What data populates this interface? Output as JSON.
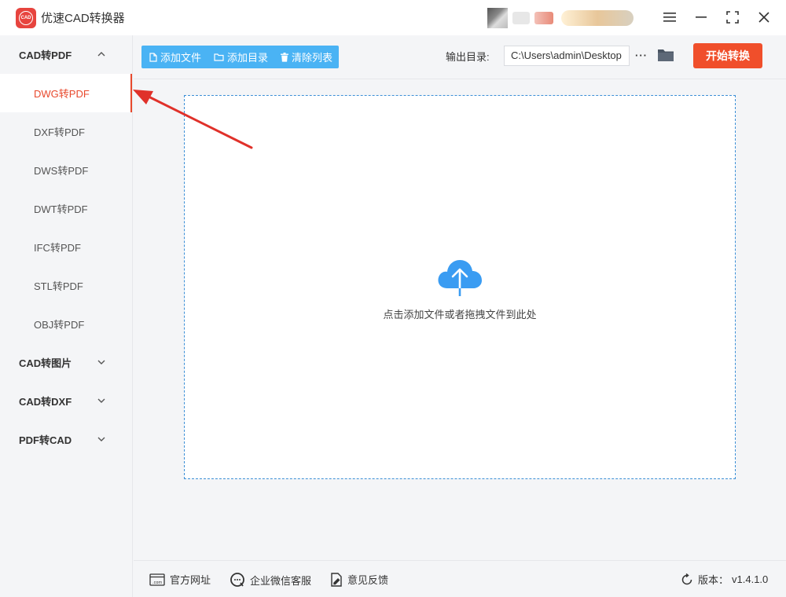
{
  "app": {
    "title": "优速CAD转换器",
    "logo_text": "CAD"
  },
  "sidebar": {
    "groups": [
      {
        "label": "CAD转PDF",
        "expanded": true,
        "items": [
          {
            "label": "DWG转PDF",
            "active": true
          },
          {
            "label": "DXF转PDF"
          },
          {
            "label": "DWS转PDF"
          },
          {
            "label": "DWT转PDF"
          },
          {
            "label": "IFC转PDF"
          },
          {
            "label": "STL转PDF"
          },
          {
            "label": "OBJ转PDF"
          }
        ]
      },
      {
        "label": "CAD转图片",
        "expanded": false
      },
      {
        "label": "CAD转DXF",
        "expanded": false
      },
      {
        "label": "PDF转CAD",
        "expanded": false
      }
    ]
  },
  "toolbar": {
    "add_file": "添加文件",
    "add_folder": "添加目录",
    "clear_list": "清除列表",
    "output_label": "输出目录:",
    "output_path": "C:\\Users\\admin\\Desktop",
    "more": "···",
    "start": "开始转换"
  },
  "dropzone": {
    "hint": "点击添加文件或者拖拽文件到此处"
  },
  "footer": {
    "website": "官方网址",
    "wechat": "企业微信客服",
    "feedback": "意见反馈",
    "version_label": "版本：",
    "version": "v1.4.1.0"
  },
  "colors": {
    "accent": "#f04f2b",
    "toolbar_blue": "#4ab3f4",
    "active_text": "#e8492d",
    "dropzone_border": "#3b8fd6",
    "cloud": "#3a9cf2"
  }
}
